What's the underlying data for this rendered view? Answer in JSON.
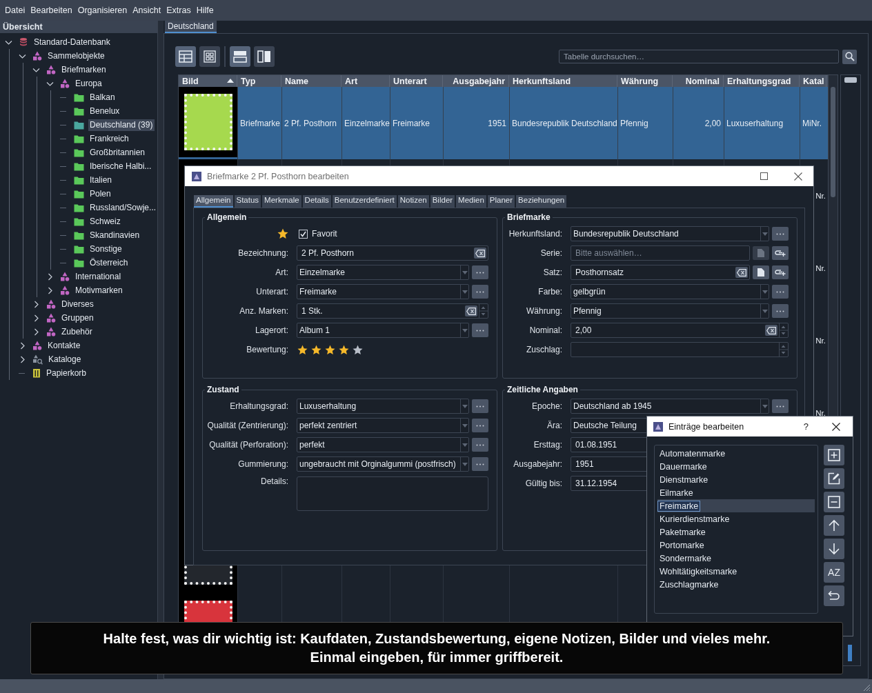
{
  "menu": [
    "Datei",
    "Bearbeiten",
    "Organisieren",
    "Ansicht",
    "Extras",
    "Hilfe"
  ],
  "sidebar": {
    "title": "Übersicht",
    "tree": [
      {
        "label": "Standard-Datenbank",
        "kind": "database",
        "expanded": true,
        "selected": false,
        "children": [
          {
            "label": "Sammelobjekte",
            "kind": "collection",
            "expanded": true,
            "selected": false,
            "children": [
              {
                "label": "Briefmarken",
                "kind": "collection",
                "expanded": true,
                "selected": false,
                "children": [
                  {
                    "label": "Europa",
                    "kind": "collection",
                    "expanded": true,
                    "selected": false,
                    "children": [
                      {
                        "label": "Balkan",
                        "kind": "folder",
                        "selected": false
                      },
                      {
                        "label": "Benelux",
                        "kind": "folder",
                        "selected": false
                      },
                      {
                        "label": "Deutschland (39)",
                        "kind": "folder",
                        "selected": true
                      },
                      {
                        "label": "Frankreich",
                        "kind": "folder",
                        "selected": false
                      },
                      {
                        "label": "Großbritannien",
                        "kind": "folder",
                        "selected": false
                      },
                      {
                        "label": "Iberische Halbi...",
                        "kind": "folder",
                        "selected": false
                      },
                      {
                        "label": "Italien",
                        "kind": "folder",
                        "selected": false
                      },
                      {
                        "label": "Polen",
                        "kind": "folder",
                        "selected": false
                      },
                      {
                        "label": "Russland/Sowje...",
                        "kind": "folder",
                        "selected": false
                      },
                      {
                        "label": "Schweiz",
                        "kind": "folder",
                        "selected": false
                      },
                      {
                        "label": "Skandinavien",
                        "kind": "folder",
                        "selected": false
                      },
                      {
                        "label": "Sonstige",
                        "kind": "folder",
                        "selected": false
                      },
                      {
                        "label": "Österreich",
                        "kind": "folder",
                        "selected": false
                      }
                    ]
                  },
                  {
                    "label": "International",
                    "kind": "collection",
                    "expanded": false,
                    "selected": false
                  },
                  {
                    "label": "Motivmarken",
                    "kind": "collection",
                    "expanded": false,
                    "selected": false
                  }
                ]
              },
              {
                "label": "Diverses",
                "kind": "collection",
                "expanded": false,
                "selected": false
              },
              {
                "label": "Gruppen",
                "kind": "collection",
                "expanded": false,
                "selected": false
              },
              {
                "label": "Zubehör",
                "kind": "collection",
                "expanded": false,
                "selected": false
              }
            ]
          },
          {
            "label": "Kontakte",
            "kind": "collection",
            "expanded": false,
            "selected": false
          },
          {
            "label": "Kataloge",
            "kind": "catalog",
            "expanded": false,
            "selected": false
          },
          {
            "label": "Papierkorb",
            "kind": "trash",
            "selected": false
          }
        ]
      }
    ]
  },
  "main": {
    "tabs": [
      {
        "label": "Deutschland",
        "selected": true
      }
    ],
    "view_buttons": [
      {
        "kind": "table",
        "selected": true
      },
      {
        "kind": "grid",
        "selected": false
      },
      {
        "kind": "split-h",
        "selected": true
      },
      {
        "kind": "split-v",
        "selected": false
      }
    ],
    "search": {
      "placeholder": "Tabelle durchsuchen…"
    },
    "table": {
      "columns": [
        {
          "label": "Bild",
          "sorted": true,
          "numeric": false
        },
        {
          "label": "Typ",
          "sorted": false,
          "numeric": false
        },
        {
          "label": "Name",
          "sorted": false,
          "numeric": false
        },
        {
          "label": "Art",
          "sorted": false,
          "numeric": false
        },
        {
          "label": "Unterart",
          "sorted": false,
          "numeric": false
        },
        {
          "label": "Ausgabejahr",
          "sorted": false,
          "numeric": true
        },
        {
          "label": "Herkunftsland",
          "sorted": false,
          "numeric": false
        },
        {
          "label": "Währung",
          "sorted": false,
          "numeric": false
        },
        {
          "label": "Nominal",
          "sorted": false,
          "numeric": true
        },
        {
          "label": "Erhaltungsgrad",
          "sorted": false,
          "numeric": false
        },
        {
          "label": "Katal",
          "sorted": false,
          "numeric": false
        }
      ],
      "rows": [
        {
          "selected": true,
          "color": "#a6d94e",
          "cells": [
            "Briefmarke",
            "2 Pf. Posthorn",
            "Einzelmarke",
            "Freimarke",
            "1951",
            "Bundesrepublik Deutschland",
            "Pfennig",
            "2,00",
            "Luxuserhaltung",
            "MiNr."
          ]
        },
        {
          "selected": false,
          "catalog": "Nr."
        },
        {
          "selected": false,
          "catalog": "Nr."
        },
        {
          "selected": false,
          "catalog": "Nr."
        },
        {
          "selected": false,
          "catalog": "Nr."
        },
        {
          "selected": false
        },
        {
          "selected": false
        },
        {
          "selected": false,
          "color": "#d8343c"
        }
      ]
    }
  },
  "edit_dialog": {
    "title": "Briefmarke 2 Pf. Posthorn bearbeiten",
    "tabs": [
      {
        "label": "Allgemein",
        "selected": true
      },
      {
        "label": "Status",
        "selected": false
      },
      {
        "label": "Merkmale",
        "selected": false
      },
      {
        "label": "Details",
        "selected": false
      },
      {
        "label": "Benutzerdefiniert",
        "selected": false
      },
      {
        "label": "Notizen",
        "selected": false
      },
      {
        "label": "Bilder",
        "selected": false
      },
      {
        "label": "Medien",
        "selected": false
      },
      {
        "label": "Planer",
        "selected": false
      },
      {
        "label": "Beziehungen",
        "selected": false
      }
    ],
    "groups": [
      {
        "title": "Allgemein",
        "fields": [
          {
            "kind": "favorite",
            "label": "Favorit",
            "checked": true
          },
          {
            "kind": "text",
            "label": "Bezeichnung:",
            "value": "2 Pf. Posthorn",
            "clearable": true
          },
          {
            "kind": "combo",
            "label": "Art:",
            "value": "Einzelmarke"
          },
          {
            "kind": "combo",
            "label": "Unterart:",
            "value": "Freimarke"
          },
          {
            "kind": "spin",
            "label": "Anz. Marken:",
            "value": "1 Stk.",
            "clearable": true
          },
          {
            "kind": "combo",
            "label": "Lagerort:",
            "value": "Album 1"
          },
          {
            "kind": "rating",
            "label": "Bewertung:",
            "stars": 4
          }
        ]
      },
      {
        "title": "Briefmarke",
        "fields": [
          {
            "kind": "combo",
            "label": "Herkunftsland:",
            "value": "Bundesrepublik Deutschland"
          },
          {
            "kind": "link",
            "label": "Serie:",
            "placeholder": "Bitte auswählen…",
            "clearable": false,
            "edit_disabled": true
          },
          {
            "kind": "link",
            "label": "Satz:",
            "value": "Posthornsatz",
            "clearable": true,
            "edit_disabled": false
          },
          {
            "kind": "combo",
            "label": "Farbe:",
            "value": "gelbgrün"
          },
          {
            "kind": "combo",
            "label": "Währung:",
            "value": "Pfennig"
          },
          {
            "kind": "spin",
            "label": "Nominal:",
            "value": "2,00",
            "clearable": true
          },
          {
            "kind": "spin",
            "label": "Zuschlag:",
            "clearable": false
          }
        ]
      },
      {
        "title": "Zustand",
        "fields": [
          {
            "kind": "combo",
            "label": "Erhaltungsgrad:",
            "value": "Luxuserhaltung"
          },
          {
            "kind": "combo",
            "label": "Qualität (Zentrierung):",
            "value": "perfekt zentriert"
          },
          {
            "kind": "combo",
            "label": "Qualität (Perforation):",
            "value": "perfekt"
          },
          {
            "kind": "combo",
            "label": "Gummierung:",
            "value": "ungebraucht mit Orginalgummi (postfrisch)"
          },
          {
            "kind": "textarea",
            "label": "Details:"
          }
        ]
      },
      {
        "title": "Zeitliche Angaben",
        "fields": [
          {
            "kind": "combo",
            "label": "Epoche:",
            "value": "Deutschland ab 1945"
          },
          {
            "kind": "combo",
            "label": "Ära:",
            "value": "Deutsche Teilung"
          },
          {
            "kind": "text",
            "label": "Ersttag:",
            "value": "01.08.1951"
          },
          {
            "kind": "text",
            "label": "Ausgabejahr:",
            "value": "1951"
          },
          {
            "kind": "text",
            "label": "Gültig bis:",
            "value": "31.12.1954"
          }
        ]
      }
    ]
  },
  "entries_dialog": {
    "title": "Einträge bearbeiten",
    "help": "?",
    "items": [
      {
        "label": "Automatenmarke",
        "selected": false
      },
      {
        "label": "Dauermarke",
        "selected": false
      },
      {
        "label": "Dienstmarke",
        "selected": false
      },
      {
        "label": "Eilmarke",
        "selected": false
      },
      {
        "label": "Freimarke",
        "selected": true
      },
      {
        "label": "Kurierdienstmarke",
        "selected": false
      },
      {
        "label": "Paketmarke",
        "selected": false
      },
      {
        "label": "Portomarke",
        "selected": false
      },
      {
        "label": "Sondermarke",
        "selected": false
      },
      {
        "label": "Wohltätigkeitsmarke",
        "selected": false
      },
      {
        "label": "Zuschlagmarke",
        "selected": false
      }
    ],
    "buttons": [
      {
        "kind": "add"
      },
      {
        "kind": "edit"
      },
      {
        "kind": "remove"
      },
      {
        "kind": "up"
      },
      {
        "kind": "down"
      },
      {
        "kind": "sort",
        "label": "AZ"
      },
      {
        "kind": "undo"
      }
    ]
  },
  "caption": {
    "text": "Halte fest, was dir wichtig ist: Kaufdaten, Zustandsbewertung, eigene Notizen, Bilder und vieles mehr.\nEinmal eingeben, für immer griffbereit."
  }
}
